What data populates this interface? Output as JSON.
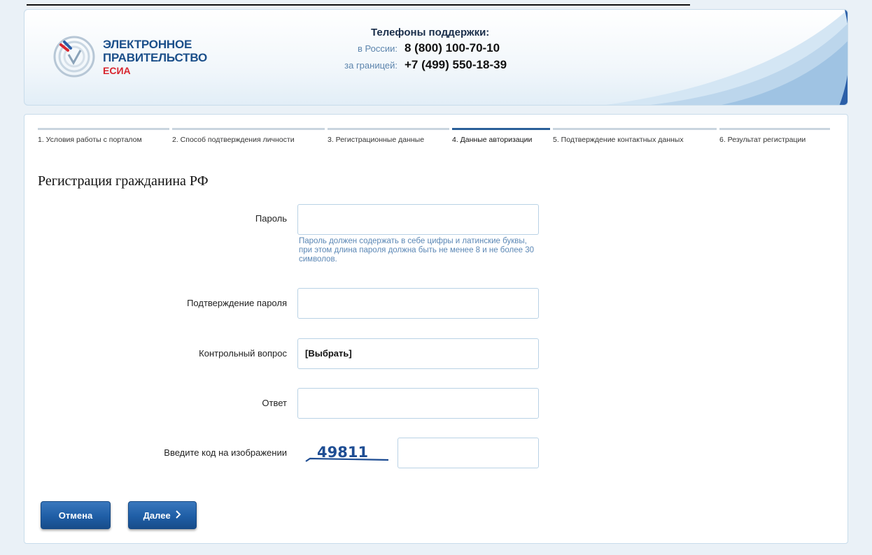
{
  "header": {
    "logo_line1": "ЭЛЕКТРОННОЕ",
    "logo_line2": "ПРАВИТЕЛЬСТВО",
    "logo_line3": "ЕСИА",
    "support_title": "Телефоны поддержки:",
    "russia_label": "в России:",
    "russia_phone": "8 (800) 100-70-10",
    "abroad_label": "за границей:",
    "abroad_phone": "+7 (499) 550-18-39"
  },
  "steps": [
    {
      "label": "1. Условия работы с порталом",
      "active": false
    },
    {
      "label": "2. Способ подтверждения личности",
      "active": false
    },
    {
      "label": "3. Регистрационные данные",
      "active": false
    },
    {
      "label": "4. Данные авторизации",
      "active": true
    },
    {
      "label": "5. Подтверждение контактных данных",
      "active": false
    },
    {
      "label": "6. Результат регистрации",
      "active": false
    }
  ],
  "page_title": "Регистрация гражданина РФ",
  "form": {
    "password_label": "Пароль",
    "password_value": "",
    "password_hint": "Пароль должен содержать в себе цифры и латинские буквы, при этом длина пароля должна быть не менее 8 и не более 30 символов.",
    "confirm_label": "Подтверждение пароля",
    "confirm_value": "",
    "question_label": "Контрольный вопрос",
    "question_value": "[Выбрать]",
    "answer_label": "Ответ",
    "answer_value": "",
    "captcha_label": "Введите код на изображении",
    "captcha_code": "49811",
    "captcha_value": ""
  },
  "buttons": {
    "cancel": "Отмена",
    "next": "Далее",
    "next_icon": "chevron-right-icon"
  },
  "colors": {
    "brand_blue": "#1b4f8a",
    "brand_red": "#d8262f",
    "button_blue": "#1f5ea6",
    "hint_blue": "#5b87b5"
  }
}
